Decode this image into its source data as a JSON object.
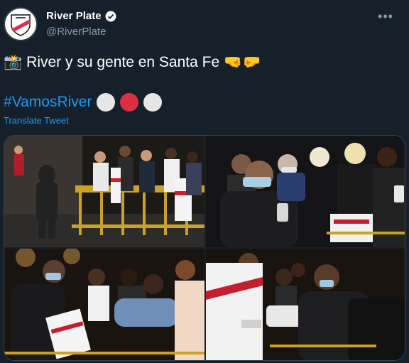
{
  "account": {
    "display_name": "River Plate",
    "handle": "@RiverPlate",
    "avatar_icon": "river-plate-crest-icon",
    "verified_icon": "verified-badge-icon"
  },
  "tweet": {
    "line1_emoji": "📸",
    "line1_text": "River y su gente en Santa Fe",
    "line1_trailing_emojis": "🤜🤛",
    "hashtag": "#VamosRiver",
    "circles": [
      "#e6e6e6",
      "#dd2e44",
      "#e6e6e6"
    ],
    "translate_label": "Translate Tweet"
  },
  "more_icon": "more-options-icon",
  "colors": {
    "background": "#15202b",
    "link": "#1d9bf0",
    "secondary_text": "#8899a6",
    "border": "#38444d"
  },
  "media": {
    "photos": [
      {
        "description": "photo-1"
      },
      {
        "description": "photo-2"
      },
      {
        "description": "photo-3"
      },
      {
        "description": "photo-4"
      }
    ]
  }
}
